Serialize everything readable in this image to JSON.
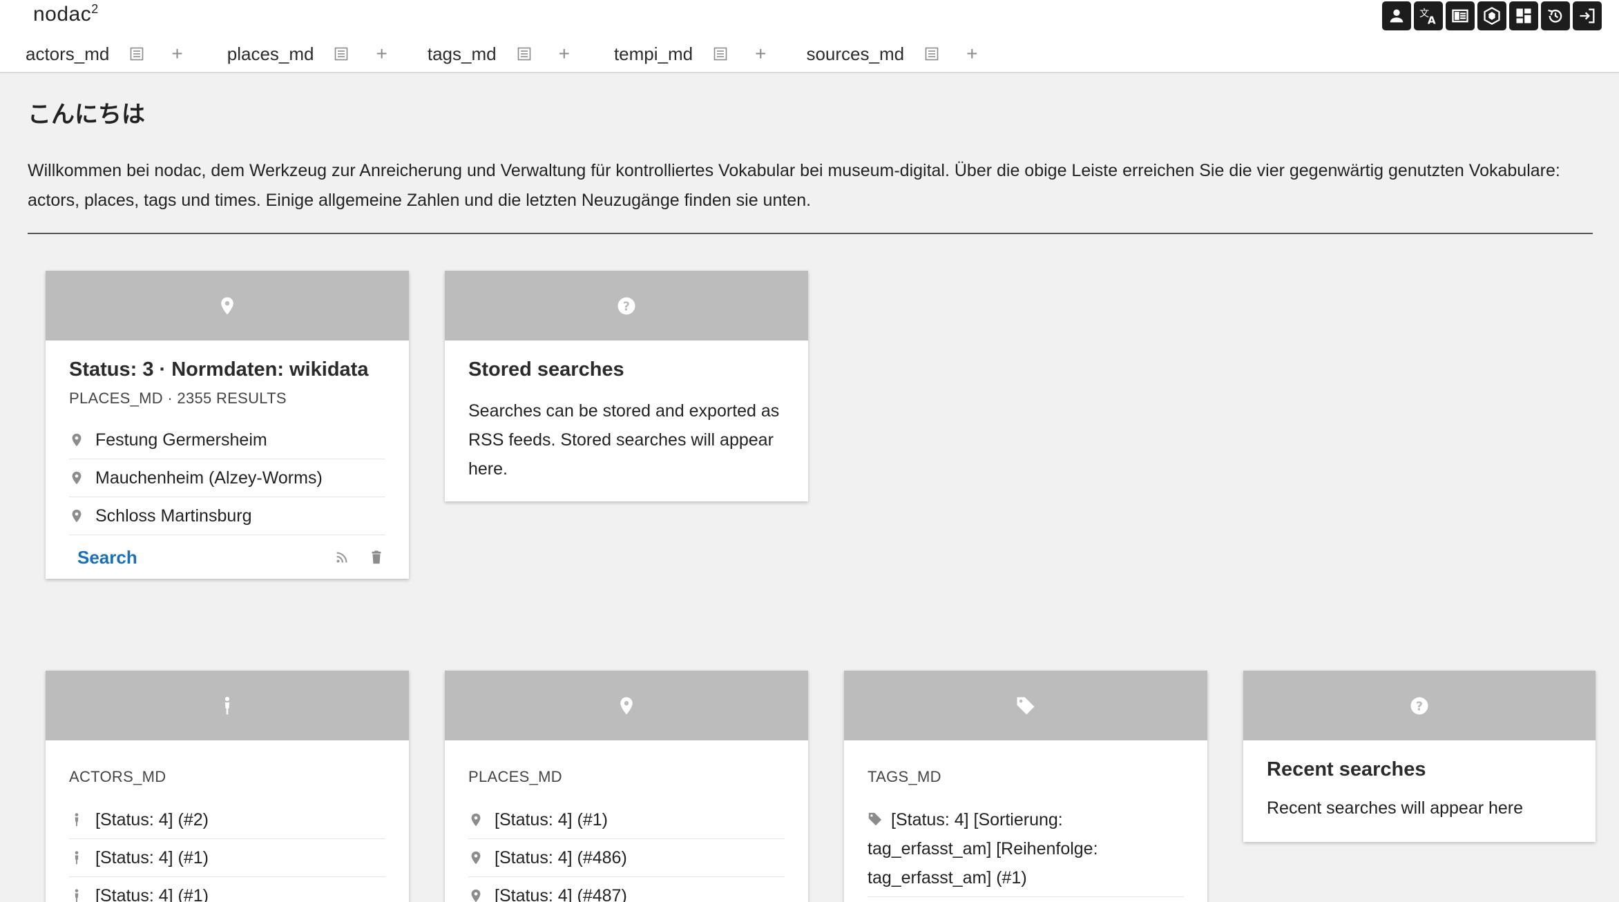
{
  "app": {
    "name": "nodac",
    "sup": "2"
  },
  "tabs": [
    {
      "label": "actors_md"
    },
    {
      "label": "places_md"
    },
    {
      "label": "tags_md"
    },
    {
      "label": "tempi_md"
    },
    {
      "label": "sources_md"
    }
  ],
  "toolbar": {
    "icons": [
      "user-icon",
      "translate-icon",
      "reader-icon",
      "hexagon-icon",
      "dashboard-icon",
      "history-icon",
      "logout-icon"
    ]
  },
  "greeting": "こんにちは",
  "intro_text": "Willkommen bei nodac, dem Werkzeug zur Anreicherung und Verwaltung für kontrolliertes Vokabular bei museum-digital. Über die obige Leiste erreichen Sie die vier gegenwärtig genutzten Vokabulare: actors, places, tags und times. Einige allgemeine Zahlen und die letzten Neuzugänge finden sie unten.",
  "saved_search_card": {
    "icon": "map-marker-icon",
    "title": "Status: 3 · Normdaten: wikidata",
    "subtitle": "PLACES_MD · 2355 RESULTS",
    "items": [
      "Festung Germersheim",
      "Mauchenheim (Alzey-Worms)",
      "Schloss Martinsburg"
    ],
    "search_label": "Search",
    "footer_icons": [
      "rss-icon",
      "trash-icon"
    ]
  },
  "stored_searches_card": {
    "icon": "help-circle-icon",
    "title": "Stored searches",
    "text": "Searches can be stored and exported as RSS feeds. Stored searches will appear here."
  },
  "actors_card": {
    "icon": "person-icon",
    "subtitle": "ACTORS_MD",
    "items": [
      "[Status: 4] (#2)",
      "[Status: 4] (#1)",
      "[Status: 4] (#1)"
    ]
  },
  "places_card": {
    "icon": "map-marker-icon",
    "subtitle": "PLACES_MD",
    "items": [
      "[Status: 4] (#1)",
      "[Status: 4] (#486)",
      "[Status: 4] (#487)"
    ]
  },
  "tags_card": {
    "icon": "tag-icon",
    "subtitle": "TAGS_MD",
    "items": [
      "[Status: 4] [Sortierung: tag_erfasst_am] [Reihenfolge: tag_erfasst_am] (#1)"
    ]
  },
  "recent_searches_card": {
    "icon": "help-circle-icon",
    "title": "Recent searches",
    "text": "Recent searches will appear here"
  },
  "colors": {
    "accent_link": "#1a6fb5",
    "card_header": "#bcbcbc",
    "toolbar_button": "#1d1d1d"
  }
}
